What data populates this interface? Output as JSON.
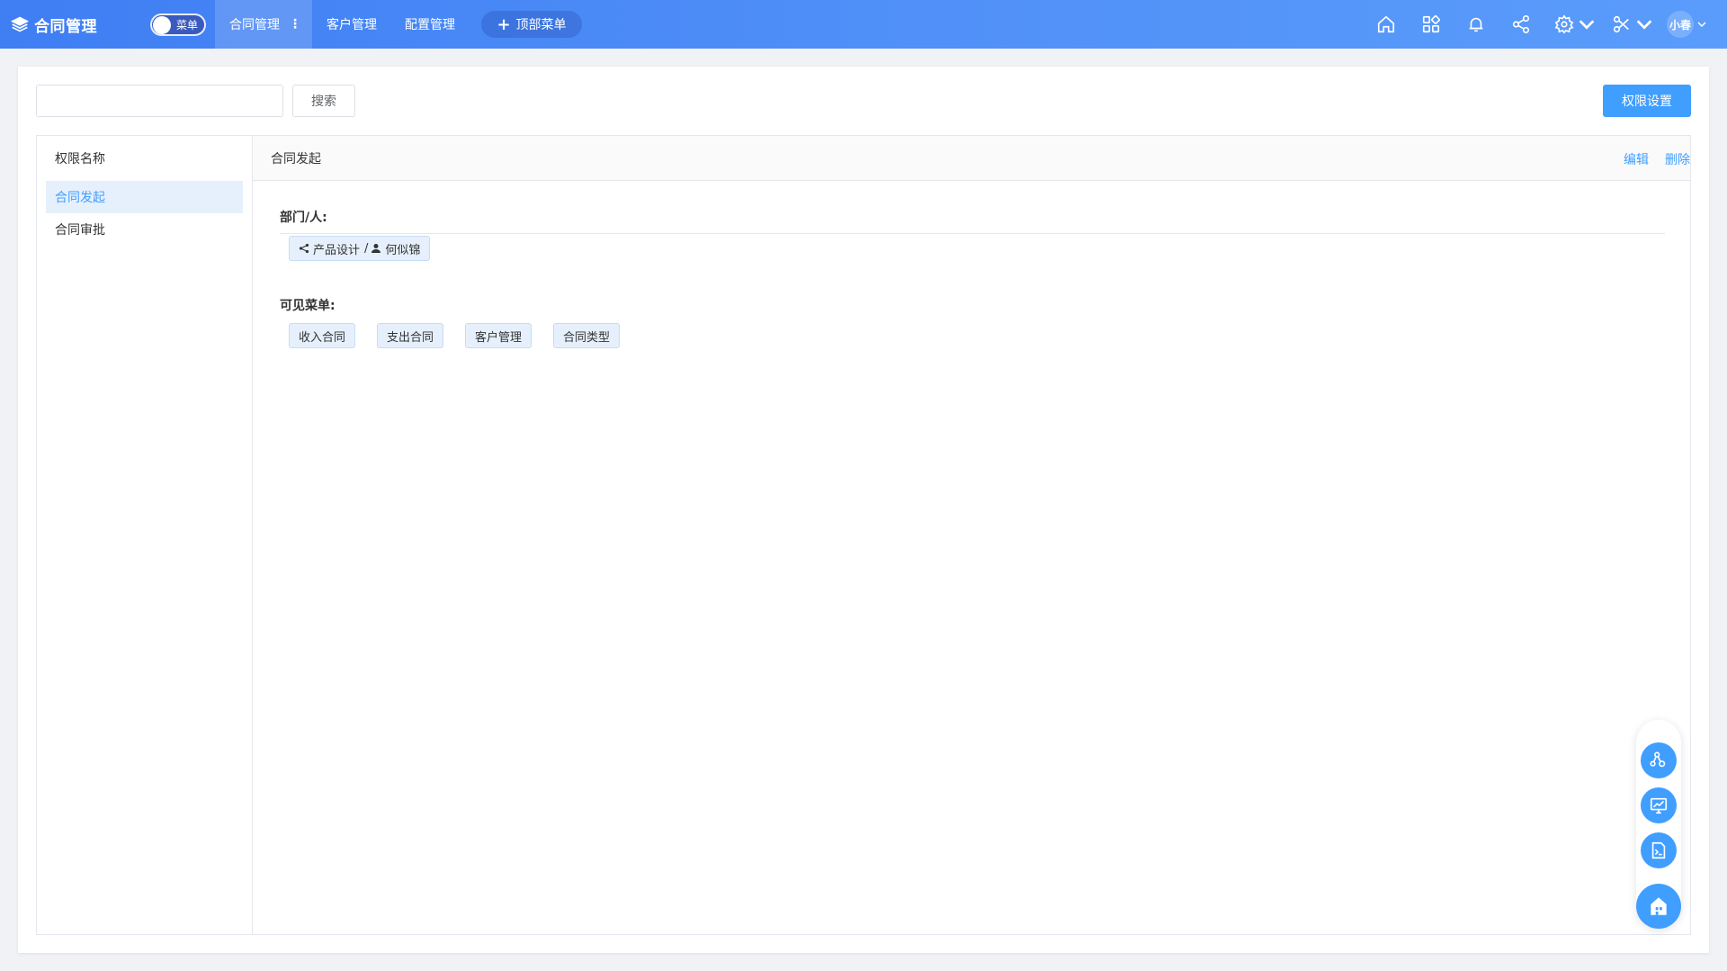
{
  "app": {
    "title": "合同管理"
  },
  "menu_toggle": {
    "label": "菜单",
    "state": "on"
  },
  "nav": {
    "tabs": [
      {
        "label": "合同管理",
        "active": true
      },
      {
        "label": "客户管理",
        "active": false
      },
      {
        "label": "配置管理",
        "active": false
      }
    ],
    "add_top_menu": "顶部菜单"
  },
  "toolbar_icons": [
    "home-icon",
    "apps-icon",
    "bell-icon",
    "share-icon",
    "gear-icon",
    "tools-icon"
  ],
  "user": {
    "name": "小春"
  },
  "search": {
    "placeholder": "",
    "value": "",
    "button": "搜索"
  },
  "permission_settings_button": "权限设置",
  "permission_list": {
    "header": "权限名称",
    "items": [
      {
        "label": "合同发起",
        "selected": true
      },
      {
        "label": "合同审批",
        "selected": false
      }
    ]
  },
  "detail": {
    "title": "合同发起",
    "actions": {
      "edit": "编辑",
      "delete": "删除"
    },
    "dept_people": {
      "label": "部门/人:",
      "tags": [
        {
          "department": "产品设计",
          "separator": "/",
          "person": "何似锦"
        }
      ]
    },
    "visible_menus": {
      "label": "可见菜单:",
      "tags": [
        "收入合同",
        "支出合同",
        "客户管理",
        "合同类型"
      ]
    }
  },
  "colors": {
    "topbar_start": "#3f7ef3",
    "topbar_end": "#5a9cfb",
    "primary": "#409eff",
    "tag_bg": "#e6f0fc"
  },
  "float_buttons": [
    "org-settings-icon",
    "monitor-chart-icon",
    "terminal-doc-icon",
    "building-icon"
  ]
}
